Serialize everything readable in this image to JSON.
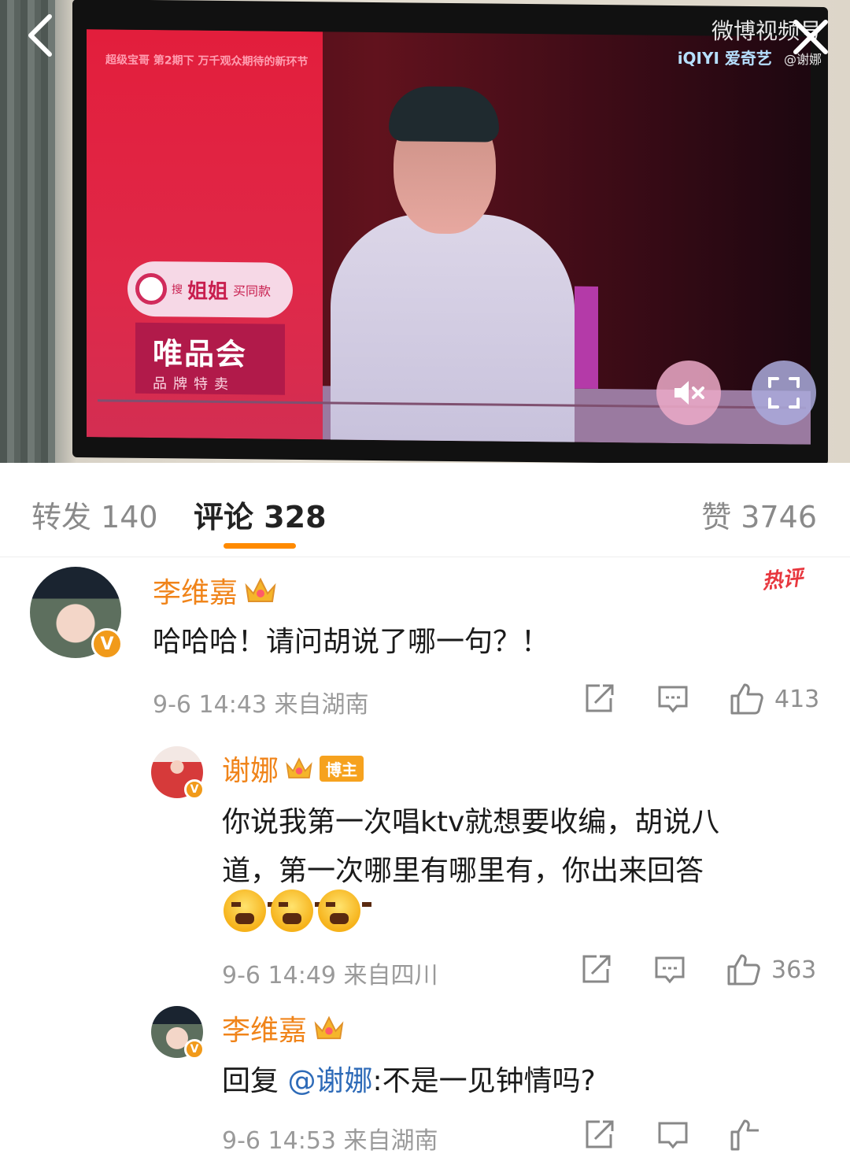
{
  "video": {
    "screen_topline": "超级宝哥 第2期下 万千观众期待的新环节",
    "ad_search_prefix": "搜",
    "ad_search_term": "姐姐",
    "ad_search_suffix": "买同款",
    "ad_brand": "唯品会",
    "ad_brand_sub": "品牌特卖",
    "watermark_weibo": "微博视频号",
    "watermark_iqiyi": "iQIYI 爱奇艺",
    "watermark_author": "@谢娜",
    "icons": {
      "back": "back-arrow-icon",
      "close": "close-icon",
      "mute": "mute-icon",
      "fullscreen": "fullscreen-icon"
    }
  },
  "tabs": {
    "repost": "转发 140",
    "comments": "评论 328",
    "likes": "赞 3746",
    "active_color": "#ff8a00"
  },
  "comments": [
    {
      "user": "李维嘉",
      "badge": "V",
      "hot_label": "热评",
      "text": "哈哈哈！请问胡说了哪一句？！",
      "meta": "9-6 14:43 来自湖南",
      "likes": "413",
      "replies": [
        {
          "user": "谢娜",
          "badge": "V",
          "author_tag": "博主",
          "text_line1": "你说我第一次唱ktv就想要收编，胡说八",
          "text_line2": "道，第一次哪里有哪里有，你出来回答",
          "emoji_name": "angry-face-emoji",
          "meta": "9-6 14:49 来自四川",
          "likes": "363"
        },
        {
          "user": "李维嘉",
          "badge": "V",
          "reply_prefix": "回复",
          "mention": "@谢娜",
          "text": ":不是一见钟情吗?",
          "meta": "9-6 14:53 来自湖南"
        }
      ]
    }
  ],
  "colors": {
    "username": "#f0841a",
    "mention": "#2e6bb8",
    "meta": "#9a9a9a",
    "hot": "#e8373e"
  }
}
